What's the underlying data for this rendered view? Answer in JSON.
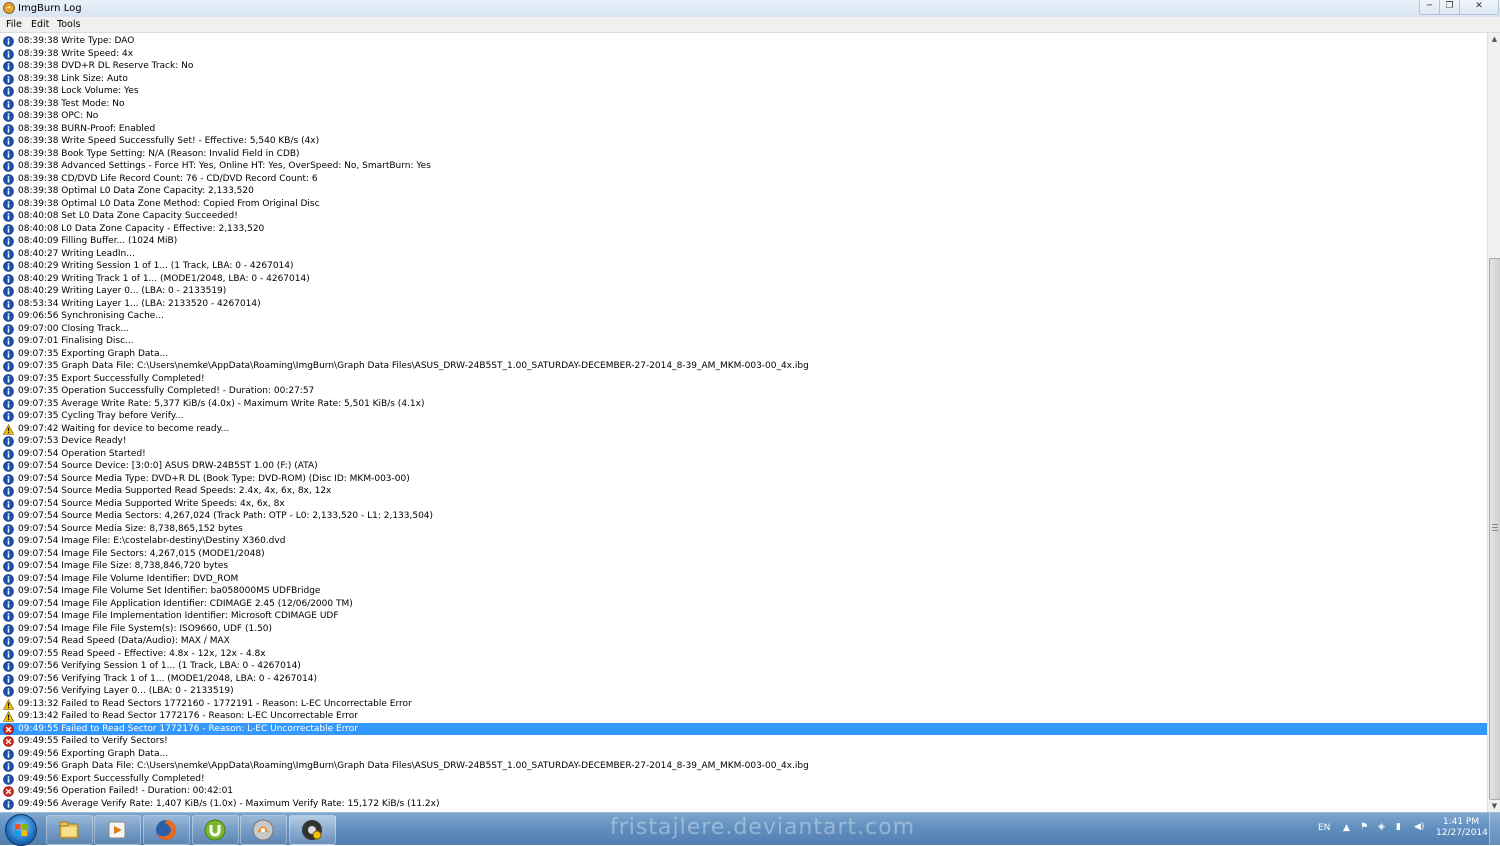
{
  "window": {
    "title": "ImgBurn Log",
    "min_glyph": "─",
    "max_glyph": "❐",
    "close_glyph": "✕"
  },
  "menu": [
    "File",
    "Edit",
    "Tools"
  ],
  "log": [
    {
      "type": "info",
      "text": "08:39:38 Write Type: DAO"
    },
    {
      "type": "info",
      "text": "08:39:38 Write Speed: 4x"
    },
    {
      "type": "info",
      "text": "08:39:38 DVD+R DL Reserve Track: No"
    },
    {
      "type": "info",
      "text": "08:39:38 Link Size: Auto"
    },
    {
      "type": "info",
      "text": "08:39:38 Lock Volume: Yes"
    },
    {
      "type": "info",
      "text": "08:39:38 Test Mode: No"
    },
    {
      "type": "info",
      "text": "08:39:38 OPC: No"
    },
    {
      "type": "info",
      "text": "08:39:38 BURN-Proof: Enabled"
    },
    {
      "type": "info",
      "text": "08:39:38 Write Speed Successfully Set! - Effective: 5,540 KB/s (4x)"
    },
    {
      "type": "info",
      "text": "08:39:38 Book Type Setting: N/A (Reason: Invalid Field in CDB)"
    },
    {
      "type": "info",
      "text": "08:39:38 Advanced Settings - Force HT: Yes, Online HT: Yes, OverSpeed: No, SmartBurn: Yes"
    },
    {
      "type": "info",
      "text": "08:39:38 CD/DVD Life Record Count: 76 - CD/DVD Record Count: 6"
    },
    {
      "type": "info",
      "text": "08:39:38 Optimal L0 Data Zone Capacity: 2,133,520"
    },
    {
      "type": "info",
      "text": "08:39:38 Optimal L0 Data Zone Method: Copied From Original Disc"
    },
    {
      "type": "info",
      "text": "08:40:08 Set L0 Data Zone Capacity Succeeded!"
    },
    {
      "type": "info",
      "text": "08:40:08 L0 Data Zone Capacity - Effective: 2,133,520"
    },
    {
      "type": "info",
      "text": "08:40:09 Filling Buffer... (1024 MiB)"
    },
    {
      "type": "info",
      "text": "08:40:27 Writing LeadIn..."
    },
    {
      "type": "info",
      "text": "08:40:29 Writing Session 1 of 1... (1 Track, LBA: 0 - 4267014)"
    },
    {
      "type": "info",
      "text": "08:40:29 Writing Track 1 of 1... (MODE1/2048, LBA: 0 - 4267014)"
    },
    {
      "type": "info",
      "text": "08:40:29 Writing Layer 0... (LBA: 0 - 2133519)"
    },
    {
      "type": "info",
      "text": "08:53:34 Writing Layer 1... (LBA: 2133520 - 4267014)"
    },
    {
      "type": "info",
      "text": "09:06:56 Synchronising Cache..."
    },
    {
      "type": "info",
      "text": "09:07:00 Closing Track..."
    },
    {
      "type": "info",
      "text": "09:07:01 Finalising Disc..."
    },
    {
      "type": "info",
      "text": "09:07:35 Exporting Graph Data..."
    },
    {
      "type": "info",
      "text": "09:07:35 Graph Data File: C:\\Users\\nemke\\AppData\\Roaming\\ImgBurn\\Graph Data Files\\ASUS_DRW-24B5ST_1.00_SATURDAY-DECEMBER-27-2014_8-39_AM_MKM-003-00_4x.ibg"
    },
    {
      "type": "info",
      "text": "09:07:35 Export Successfully Completed!"
    },
    {
      "type": "info",
      "text": "09:07:35 Operation Successfully Completed! - Duration: 00:27:57"
    },
    {
      "type": "info",
      "text": "09:07:35 Average Write Rate: 5,377 KiB/s (4.0x) - Maximum Write Rate: 5,501 KiB/s (4.1x)"
    },
    {
      "type": "info",
      "text": "09:07:35 Cycling Tray before Verify..."
    },
    {
      "type": "warning",
      "text": "09:07:42 Waiting for device to become ready..."
    },
    {
      "type": "info",
      "text": "09:07:53 Device Ready!"
    },
    {
      "type": "info",
      "text": "09:07:54 Operation Started!"
    },
    {
      "type": "info",
      "text": "09:07:54 Source Device: [3:0:0] ASUS DRW-24B5ST 1.00 (F:) (ATA)"
    },
    {
      "type": "info",
      "text": "09:07:54 Source Media Type: DVD+R DL (Book Type: DVD-ROM) (Disc ID: MKM-003-00)"
    },
    {
      "type": "info",
      "text": "09:07:54 Source Media Supported Read Speeds: 2.4x, 4x, 6x, 8x, 12x"
    },
    {
      "type": "info",
      "text": "09:07:54 Source Media Supported Write Speeds: 4x, 6x, 8x"
    },
    {
      "type": "info",
      "text": "09:07:54 Source Media Sectors: 4,267,024 (Track Path: OTP - L0: 2,133,520 - L1: 2,133,504)"
    },
    {
      "type": "info",
      "text": "09:07:54 Source Media Size: 8,738,865,152 bytes"
    },
    {
      "type": "info",
      "text": "09:07:54 Image File: E:\\costelabr-destiny\\Destiny X360.dvd"
    },
    {
      "type": "info",
      "text": "09:07:54 Image File Sectors: 4,267,015 (MODE1/2048)"
    },
    {
      "type": "info",
      "text": "09:07:54 Image File Size: 8,738,846,720 bytes"
    },
    {
      "type": "info",
      "text": "09:07:54 Image File Volume Identifier: DVD_ROM"
    },
    {
      "type": "info",
      "text": "09:07:54 Image File Volume Set Identifier: ba058000MS UDFBridge"
    },
    {
      "type": "info",
      "text": "09:07:54 Image File Application Identifier: CDIMAGE 2.45 (12/06/2000 TM)"
    },
    {
      "type": "info",
      "text": "09:07:54 Image File Implementation Identifier: Microsoft CDIMAGE UDF"
    },
    {
      "type": "info",
      "text": "09:07:54 Image File File System(s): ISO9660, UDF (1.50)"
    },
    {
      "type": "info",
      "text": "09:07:54 Read Speed (Data/Audio): MAX / MAX"
    },
    {
      "type": "info",
      "text": "09:07:55 Read Speed - Effective: 4.8x - 12x, 12x - 4.8x"
    },
    {
      "type": "info",
      "text": "09:07:56 Verifying Session 1 of 1... (1 Track, LBA: 0 - 4267014)"
    },
    {
      "type": "info",
      "text": "09:07:56 Verifying Track 1 of 1... (MODE1/2048, LBA: 0 - 4267014)"
    },
    {
      "type": "info",
      "text": "09:07:56 Verifying Layer 0... (LBA: 0 - 2133519)"
    },
    {
      "type": "warning",
      "text": "09:13:32 Failed to Read Sectors 1772160 - 1772191 - Reason: L-EC Uncorrectable Error"
    },
    {
      "type": "warning",
      "text": "09:13:42 Failed to Read Sector 1772176 - Reason: L-EC Uncorrectable Error"
    },
    {
      "type": "error",
      "text": "09:49:55 Failed to Read Sector 1772176 - Reason: L-EC Uncorrectable Error",
      "selected": true
    },
    {
      "type": "error",
      "text": "09:49:55 Failed to Verify Sectors!"
    },
    {
      "type": "info",
      "text": "09:49:56 Exporting Graph Data..."
    },
    {
      "type": "info",
      "text": "09:49:56 Graph Data File: C:\\Users\\nemke\\AppData\\Roaming\\ImgBurn\\Graph Data Files\\ASUS_DRW-24B5ST_1.00_SATURDAY-DECEMBER-27-2014_8-39_AM_MKM-003-00_4x.ibg"
    },
    {
      "type": "info",
      "text": "09:49:56 Export Successfully Completed!"
    },
    {
      "type": "error",
      "text": "09:49:56 Operation Failed! - Duration: 00:42:01"
    },
    {
      "type": "info",
      "text": "09:49:56 Average Verify Rate: 1,407 KiB/s (1.0x) - Maximum Verify Rate: 15,172 KiB/s (11.2x)"
    }
  ],
  "colors": {
    "info": "#1a4fb0",
    "warning": "#f2c200",
    "error": "#d42a1e",
    "selection": "#3399ff"
  },
  "taskbar": {
    "apps": [
      "explorer",
      "media-player",
      "firefox",
      "utorrent",
      "imgburn",
      "imgburn-log"
    ],
    "watermark": "fristajlere.deviantart.com",
    "language": "EN",
    "time": "1:41 PM",
    "date": "12/27/2014"
  }
}
